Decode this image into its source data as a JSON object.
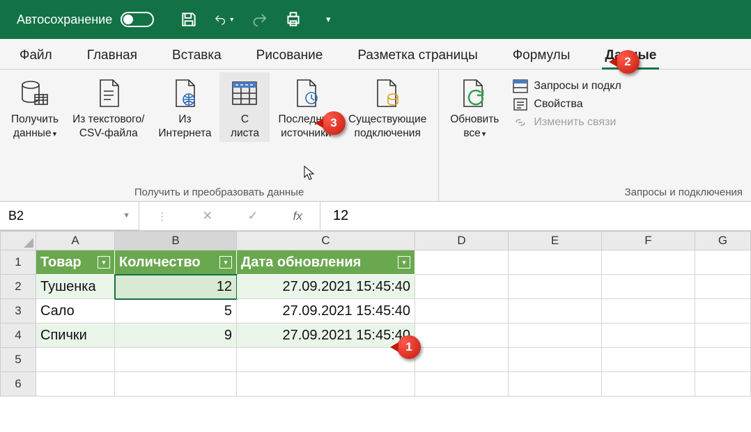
{
  "titlebar": {
    "autosave": "Автосохранение"
  },
  "tabs": [
    "Файл",
    "Главная",
    "Вставка",
    "Рисование",
    "Разметка страницы",
    "Формулы",
    "Данные"
  ],
  "active_tab": "Данные",
  "ribbon": {
    "group1": {
      "label": "Получить и преобразовать данные",
      "buttons": {
        "get_data": {
          "l1": "Получить",
          "l2": "данные"
        },
        "from_csv": {
          "l1": "Из текстового/",
          "l2": "CSV-файла"
        },
        "from_web": {
          "l1": "Из",
          "l2": "Интернета"
        },
        "from_sheet": {
          "l1": "С",
          "l2": "листа"
        },
        "recent": {
          "l1": "Последние",
          "l2": "источники"
        },
        "existing": {
          "l1": "Существующие",
          "l2": "подключения"
        }
      }
    },
    "group2": {
      "label": "Запросы и подключения",
      "refresh": {
        "l1": "Обновить",
        "l2": "все"
      },
      "side": {
        "queries": "Запросы и подкл",
        "props": "Свойства",
        "links": "Изменить связи"
      }
    }
  },
  "formula_bar": {
    "name": "B2",
    "value": "12"
  },
  "sheet": {
    "columns": [
      "A",
      "B",
      "C",
      "D",
      "E",
      "F",
      "G"
    ],
    "selected_col": "B",
    "rows": [
      "1",
      "2",
      "3",
      "4",
      "5",
      "6"
    ],
    "headers": [
      "Товар",
      "Количество",
      "Дата обновления"
    ],
    "data": [
      {
        "a": "Тушенка",
        "b": "12",
        "c": "27.09.2021 15:45:40"
      },
      {
        "a": "Сало",
        "b": "5",
        "c": "27.09.2021 15:45:40"
      },
      {
        "a": "Спички",
        "b": "9",
        "c": "27.09.2021 15:45:40"
      }
    ]
  },
  "callouts": {
    "c1": "1",
    "c2": "2",
    "c3": "3"
  }
}
